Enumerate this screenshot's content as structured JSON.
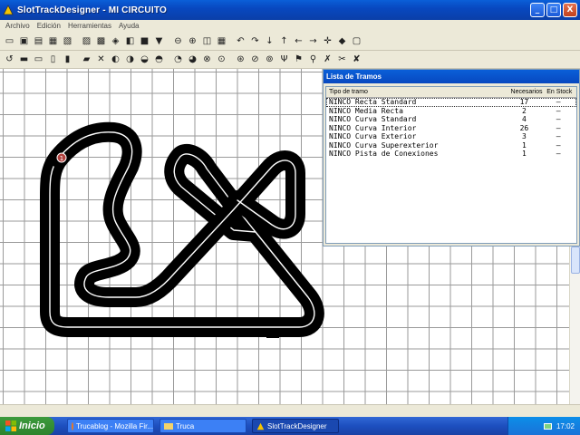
{
  "window": {
    "title": "SlotTrackDesigner - MI CIRCUITO",
    "controls": {
      "minimize": "_",
      "maximize": "□",
      "close": "X"
    }
  },
  "menu": {
    "items": [
      "Archivo",
      "Edición",
      "Herramientas",
      "Ayuda"
    ]
  },
  "toolbar1_icons": [
    "new-icon",
    "open-icon",
    "save-icon",
    "print-icon",
    "preview-icon",
    "properties-icon",
    "copy-icon",
    "paste-icon",
    "layers-icon",
    "color-fill-icon",
    "color-picker-icon",
    "zoom-out-icon",
    "zoom-in-icon",
    "zoom-fit-icon",
    "grid-icon",
    "rotate-left-icon",
    "rotate-right-icon",
    "arrow-down-icon",
    "arrow-up-icon",
    "arrow-left-icon",
    "arrow-right-icon",
    "move-icon",
    "palette-icon",
    "clear-icon"
  ],
  "toolbar2_icons": [
    "undo-icon",
    "track-straight-icon",
    "track-lanes-icon",
    "track-half-icon",
    "track-quarter-icon",
    "track-double-icon",
    "track-crossover-icon",
    "track-end-icon",
    "track-mid-icon",
    "track-switch-icon",
    "track-banked-icon",
    "track-jump-icon",
    "track-border-icon",
    "track-start-icon",
    "track-chicane-icon",
    "track-gate-icon",
    "track-pit-icon",
    "track-loop-icon",
    "track-tree-icon",
    "track-flag-icon",
    "track-pin-icon",
    "track-cross-icon",
    "track-cut-icon",
    "track-x-icon"
  ],
  "panel": {
    "title": "Lista de Tramos",
    "columns": [
      "Tipo de tramo",
      "Necesarios",
      "En Stock"
    ],
    "rows": [
      {
        "type": "NINCO Recta Standard",
        "needed": "17",
        "stock": "–"
      },
      {
        "type": "NINCO Media Recta",
        "needed": "2",
        "stock": "–"
      },
      {
        "type": "NINCO Curva Standard",
        "needed": "4",
        "stock": "–"
      },
      {
        "type": "NINCO Curva Interior",
        "needed": "26",
        "stock": "–"
      },
      {
        "type": "NINCO Curva Exterior",
        "needed": "3",
        "stock": "–"
      },
      {
        "type": "NINCO Curva Superexterior",
        "needed": "1",
        "stock": "–"
      },
      {
        "type": "NINCO Pista de Conexiones",
        "needed": "1",
        "stock": "–"
      }
    ]
  },
  "track": {
    "track_color": "#000000",
    "lane_color": "#ffffff",
    "start_marker": "1"
  },
  "taskbar": {
    "start_label": "Inicio",
    "tasks": [
      {
        "label": "Trucablog - Mozilla Fir...",
        "icon": "firefox-icon"
      },
      {
        "label": "Truca",
        "icon": "folder-icon"
      },
      {
        "label": "SlotTrackDesigner",
        "icon": "app-icon"
      }
    ],
    "language": "ES",
    "clock": "17:02"
  },
  "colors": {
    "titlebar": "#0a5fd8",
    "taskbar": "#1d4fbf",
    "start": "#3c9a3c",
    "grid": "#9a9a9a"
  }
}
